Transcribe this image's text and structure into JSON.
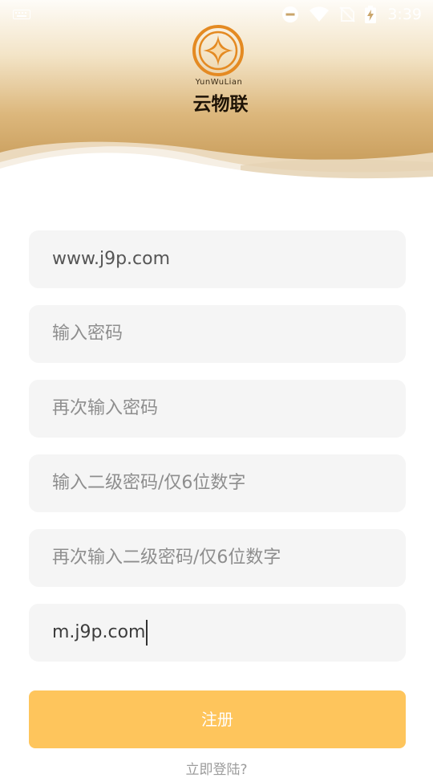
{
  "status_bar": {
    "time": "3:39"
  },
  "logo": {
    "en": "YunWuLian",
    "cn": "云物联"
  },
  "form": {
    "fields": [
      {
        "name": "username",
        "value": "www.j9p.com",
        "placeholder": ""
      },
      {
        "name": "password",
        "value": "",
        "placeholder": "输入密码"
      },
      {
        "name": "password-confirm",
        "value": "",
        "placeholder": "再次输入密码"
      },
      {
        "name": "second-password",
        "value": "",
        "placeholder": "输入二级密码/仅6位数字"
      },
      {
        "name": "second-password-confirm",
        "value": "",
        "placeholder": "再次输入二级密码/仅6位数字"
      },
      {
        "name": "invite",
        "value": "m.j9p.com",
        "placeholder": ""
      }
    ]
  },
  "register_label": "注册",
  "login_link": "立即登陆?",
  "colors": {
    "accent": "#fec55c",
    "header_gold": "#c1934f",
    "field_bg": "#f5f5f5"
  }
}
